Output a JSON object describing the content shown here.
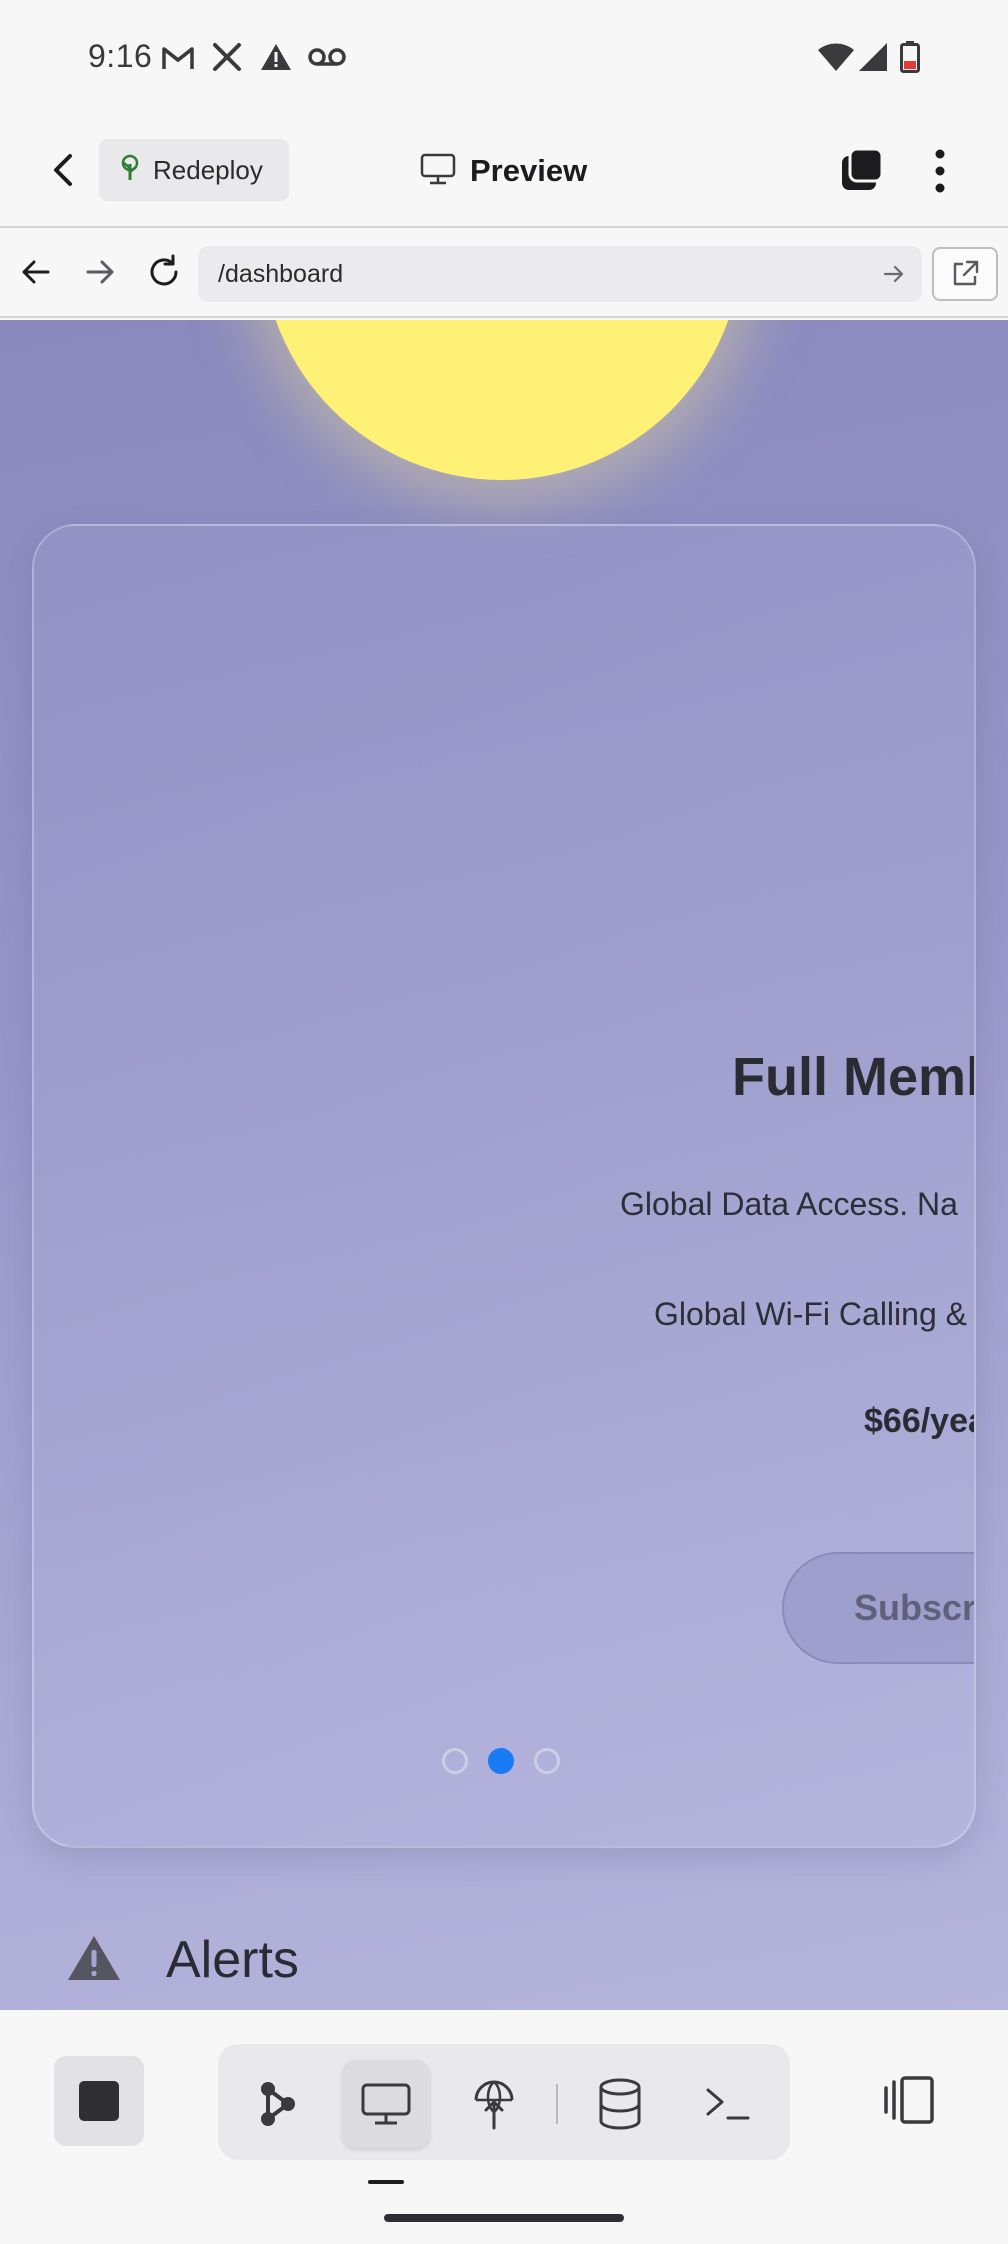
{
  "status_bar": {
    "time": "9:16",
    "left_icons": [
      "gmail-icon",
      "x-icon",
      "warning-icon",
      "voicemail-icon"
    ],
    "right_icons": [
      "wifi-icon",
      "signal-icon",
      "battery-low-icon"
    ],
    "battery_color": "#e53935"
  },
  "app_bar": {
    "back_icon": "chevron-left-icon",
    "redeploy_label": "Redeploy",
    "redeploy_icon": "tree-icon",
    "title": "Preview",
    "title_icon": "monitor-icon",
    "stack_icon": "tabs-stack-icon",
    "menu_icon": "more-vertical-icon"
  },
  "url_bar": {
    "back_icon": "arrow-left-icon",
    "forward_icon": "arrow-right-icon",
    "reload_icon": "reload-icon",
    "url": "/dashboard",
    "go_icon": "arrow-right-icon",
    "open_external_icon": "external-link-icon"
  },
  "web": {
    "card": {
      "title": "Full Memb",
      "line1": "Global Data Access. Na",
      "line2": "Global Wi-Fi Calling &",
      "price": "$66/yea",
      "subscribe_label": "Subscri"
    },
    "carousel": {
      "count": 3,
      "active_index": 1,
      "active_color": "#1a7cf5"
    },
    "alerts_label": "Alerts",
    "alerts_icon": "warning-icon"
  },
  "toolbar": {
    "stop_icon": "stop-icon",
    "tools": [
      "graph-nodes-icon",
      "monitor-icon",
      "deploy-globe-icon",
      "database-icon",
      "terminal-icon"
    ],
    "active_tool": "monitor-icon",
    "panel_icon": "panel-toggle-icon"
  }
}
